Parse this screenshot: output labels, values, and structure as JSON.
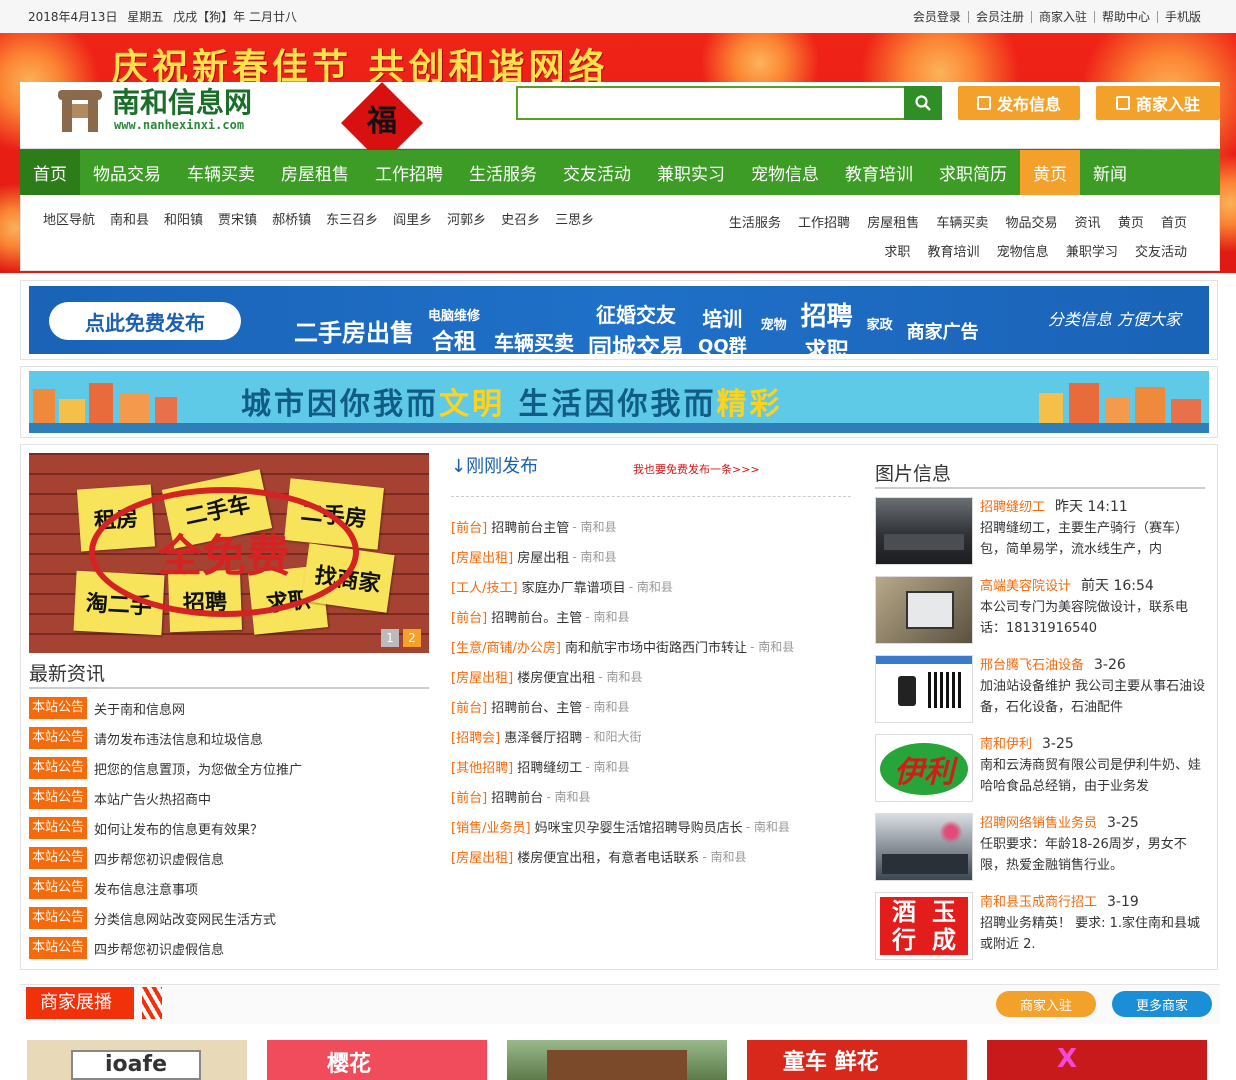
{
  "topbar": {
    "date": "2018年4月13日",
    "weekday": "星期五",
    "lunar": "戊戌【狗】年 二月廿八",
    "links": [
      "会员登录",
      "会员注册",
      "商家入驻",
      "帮助中心",
      "手机版"
    ]
  },
  "banner": {
    "slogan": "庆祝新春佳节  共创和谐网络"
  },
  "logo": {
    "title": "南和信息网",
    "url": "www.nanhexinxi.com",
    "fu": "福"
  },
  "search": {
    "placeholder": ""
  },
  "header_buttons": {
    "post": "发布信息",
    "merchant": "商家入驻"
  },
  "nav": [
    "首页",
    "物品交易",
    "车辆买卖",
    "房屋租售",
    "工作招聘",
    "生活服务",
    "交友活动",
    "兼职实习",
    "宠物信息",
    "教育培训",
    "求职简历",
    "黄页",
    "新闻"
  ],
  "subnav": {
    "regions": [
      "地区导航",
      "南和县",
      "和阳镇",
      "贾宋镇",
      "郝桥镇",
      "东三召乡",
      "阎里乡",
      "河郭乡",
      "史召乡",
      "三思乡"
    ],
    "categories": [
      "生活服务",
      "工作招聘",
      "房屋租售",
      "车辆买卖",
      "物品交易",
      "资讯",
      "黄页",
      "首页",
      "求职",
      "教育培训",
      "宠物信息",
      "兼职学习",
      "交友活动"
    ]
  },
  "ad1": {
    "button": "点此免费发布",
    "words": [
      "二手房出售",
      "电脑维修",
      "合租",
      "车辆买卖",
      "征婚交友",
      "同城交易",
      "宠物",
      "培训",
      "QQ群",
      "招聘",
      "求职",
      "家政",
      "商家广告"
    ],
    "sign": "分类信息 方便大家"
  },
  "ad2": {
    "part1": "城市因你我而",
    "hl1": "文明",
    "part2": " 生活因你我而",
    "hl2": "精彩"
  },
  "slide": {
    "notes": [
      "租房",
      "二手车",
      "二手房",
      "淘二手",
      "招聘",
      "求职",
      "找商家"
    ],
    "stamp": "全免费",
    "pages": [
      "1",
      "2"
    ]
  },
  "news": {
    "title": "最新资讯",
    "tag": "本站公告",
    "items": [
      "关于南和信息网",
      "请勿发布违法信息和垃圾信息",
      "把您的信息置顶，为您做全方位推广",
      "本站广告火热招商中",
      "如何让发布的信息更有效果？",
      "四步帮您初识虚假信息",
      "发布信息注意事项",
      "分类信息网站改变网民生活方式",
      "四步帮您初识虚假信息"
    ]
  },
  "latest": {
    "title": "↓刚刚发布",
    "link": "我也要免费发布一条>>>",
    "items": [
      {
        "cat": "[前台]",
        "title": "招聘前台主管",
        "loc": "- 南和县"
      },
      {
        "cat": "[房屋出租]",
        "title": "房屋出租",
        "loc": "- 南和县"
      },
      {
        "cat": "[工人/技工]",
        "title": "家庭办厂靠谱项目",
        "loc": "- 南和县"
      },
      {
        "cat": "[前台]",
        "title": "招聘前台。主管",
        "loc": "- 南和县"
      },
      {
        "cat": "[生意/商铺/办公房]",
        "title": "南和航宇市场中街路西门市转让",
        "loc": "- 南和县"
      },
      {
        "cat": "[房屋出租]",
        "title": "楼房便宜出租",
        "loc": "- 南和县"
      },
      {
        "cat": "[前台]",
        "title": "招聘前台、主管",
        "loc": "- 南和县"
      },
      {
        "cat": "[招聘会]",
        "title": "惠泽餐厅招聘",
        "loc": "- 和阳大街"
      },
      {
        "cat": "[其他招聘]",
        "title": "招聘缝纫工",
        "loc": "- 南和县"
      },
      {
        "cat": "[前台]",
        "title": "招聘前台",
        "loc": "- 南和县"
      },
      {
        "cat": "[销售/业务员]",
        "title": "妈咪宝贝孕婴生活馆招聘导购员店长",
        "loc": "- 南和县"
      },
      {
        "cat": "[房屋出租]",
        "title": "楼房便宜出租，有意者电话联系",
        "loc": "- 南和县"
      }
    ]
  },
  "pics": {
    "title": "图片信息",
    "items": [
      {
        "title": "招聘缝纫工",
        "date": "昨天 14:11",
        "desc": "招聘缝纫工，主要生产骑行（赛车）包，简单易学，流水线生产，内"
      },
      {
        "title": "高端美容院设计",
        "date": "前天 16:54",
        "desc": "本公司专门为美容院做设计，联系电话：18131916540"
      },
      {
        "title": "邢台腾飞石油设备",
        "date": "3-26",
        "desc": "加油站设备维护 我公司主要从事石油设备，石化设备，石油配件"
      },
      {
        "title": "南和伊利",
        "date": "3-25",
        "desc": "南和云涛商贸有限公司是伊利牛奶、娃哈哈食品总经销，由于业务发"
      },
      {
        "title": "招聘网络销售业务员",
        "date": "3-25",
        "desc": "任职要求：年龄18-26周岁，男女不限，热爱金融销售行业。"
      },
      {
        "title": "南和县玉成商行招工",
        "date": "3-19",
        "desc": "招聘业务精英！ 要求: 1.家住南和县城或附近 2."
      }
    ],
    "thumb_texts": [
      "伊利",
      "酒",
      "玉",
      "行",
      "成"
    ]
  },
  "merchants": {
    "title": "商家展播",
    "btn_join": "商家入驻",
    "btn_more": "更多商家",
    "logos": [
      "ioafe",
      "樱花",
      "",
      "童车 鲜花",
      "X"
    ]
  },
  "colors": {
    "green": "#3c9c25",
    "orange": "#f3a12a",
    "red": "#f0310a",
    "blue": "#1a5fb0"
  }
}
